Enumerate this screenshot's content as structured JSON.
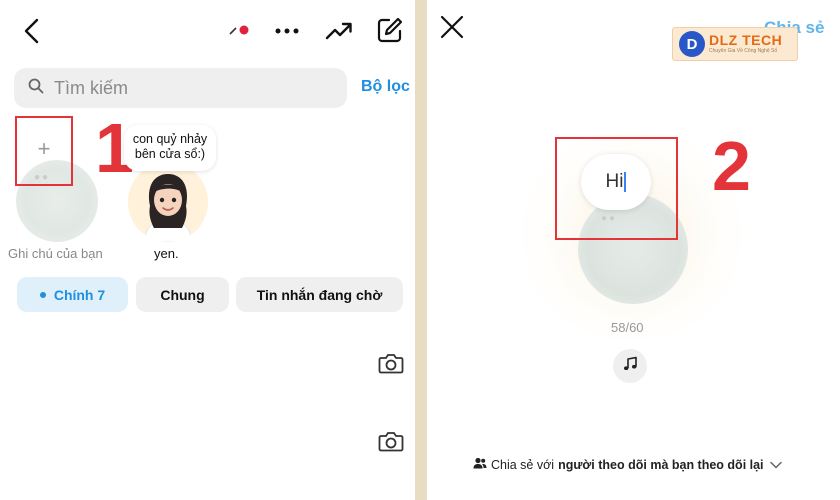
{
  "left": {
    "search": {
      "placeholder": "Tìm kiếm"
    },
    "filter_label": "Bộ lọc",
    "annotation_number": "1",
    "my_note": {
      "plus": "+",
      "label": "Ghi chú của bạn"
    },
    "friend_note": {
      "text_line1": "con quỷ nhảy",
      "text_line2": "bên cửa sổ:)",
      "name": "yen."
    },
    "tabs": [
      {
        "label": "Chính 7",
        "active": true
      },
      {
        "label": "Chung",
        "active": false
      },
      {
        "label": "Tin nhắn đang chờ",
        "active": false
      }
    ],
    "status_dot_color": "#e0213f"
  },
  "right": {
    "share_label": "Chia sẻ",
    "logo": {
      "mark": "D",
      "name": "DLZ TECH",
      "tagline": "Chuyên Gia Về Công Nghệ Số"
    },
    "note_input": "Hi",
    "annotation_number": "2",
    "char_counter": "58/60",
    "share_with_prefix": "Chia sẻ với",
    "share_with_audience": "người theo dõi mà bạn theo dõi lại"
  },
  "colors": {
    "accent": "#1f8fe0",
    "annotation": "#e3343a",
    "tab_active_bg": "#dff0fb"
  }
}
